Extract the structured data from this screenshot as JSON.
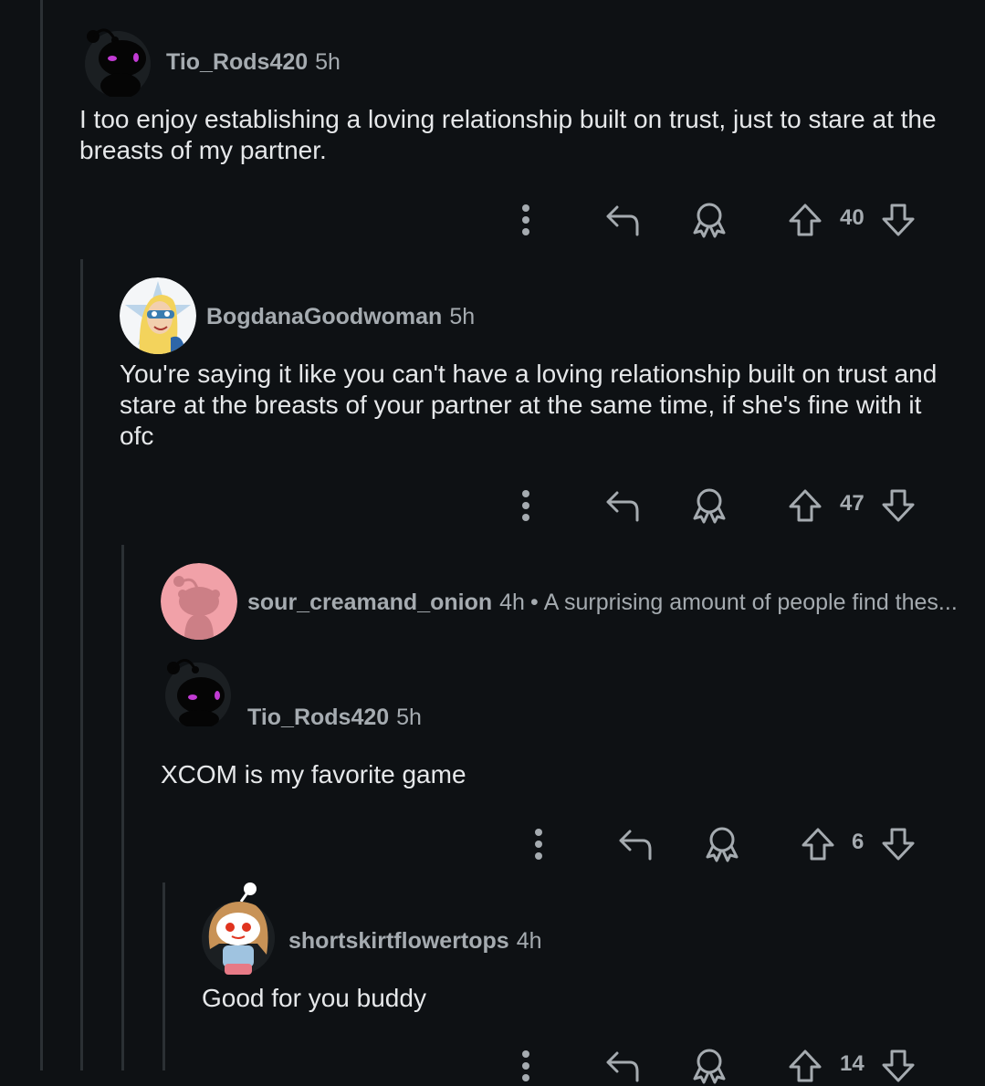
{
  "comments": [
    {
      "username": "Tio_Rods420",
      "time": "5h",
      "body": "I too enjoy establishing a loving relationship built on trust, just to stare at the breasts of my partner.",
      "score": "40"
    },
    {
      "username": "BogdanaGoodwoman",
      "time": "5h",
      "body": "You're saying it like you can't have a loving relationship built on trust and stare at the breasts of your partner at the same time, if she's fine with it ofc",
      "score": "47"
    },
    {
      "username": "sour_creamand_onion",
      "time": "4h",
      "separator": "•",
      "snippet": "A surprising amount of people find thes..."
    },
    {
      "username": "Tio_Rods420",
      "time": "5h",
      "body": "XCOM is my favorite game",
      "score": "6"
    },
    {
      "username": "shortskirtflowertops",
      "time": "4h",
      "body": "Good for you buddy",
      "score": "14"
    }
  ],
  "icons": {
    "more": "more-vertical-icon",
    "reply": "reply-arrow-icon",
    "award": "award-icon",
    "upvote": "upvote-arrow-icon",
    "downvote": "downvote-arrow-icon"
  },
  "colors": {
    "background": "#0e1114",
    "meta_text": "#a5abb0",
    "body_text": "#e6e8ea",
    "thread_line": "#2b3034",
    "snoo_pink": "#f1a1a8"
  }
}
